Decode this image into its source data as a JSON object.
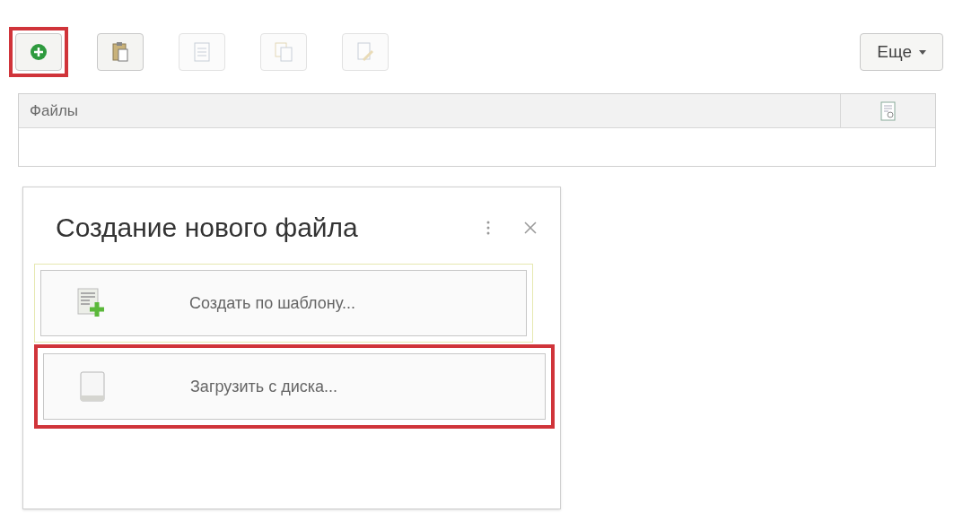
{
  "toolbar": {
    "buttons": [
      {
        "kind": "add",
        "disabled": false,
        "highlighted": true
      },
      {
        "kind": "paste",
        "disabled": false,
        "highlighted": false
      },
      {
        "kind": "document",
        "disabled": true,
        "highlighted": false
      },
      {
        "kind": "copy",
        "disabled": true,
        "highlighted": false
      },
      {
        "kind": "edit",
        "disabled": true,
        "highlighted": false
      }
    ],
    "more": {
      "label": "Еще"
    }
  },
  "table": {
    "columns": [
      {
        "label": "Файлы",
        "kind": "text"
      },
      {
        "kind": "signature"
      }
    ]
  },
  "dialog": {
    "title": "Создание нового файла",
    "buttons": [
      {
        "label": "Создать по шаблону...",
        "kind": "template",
        "highlighted": false
      },
      {
        "label": "Загрузить с диска...",
        "kind": "disk",
        "highlighted": true
      }
    ]
  }
}
